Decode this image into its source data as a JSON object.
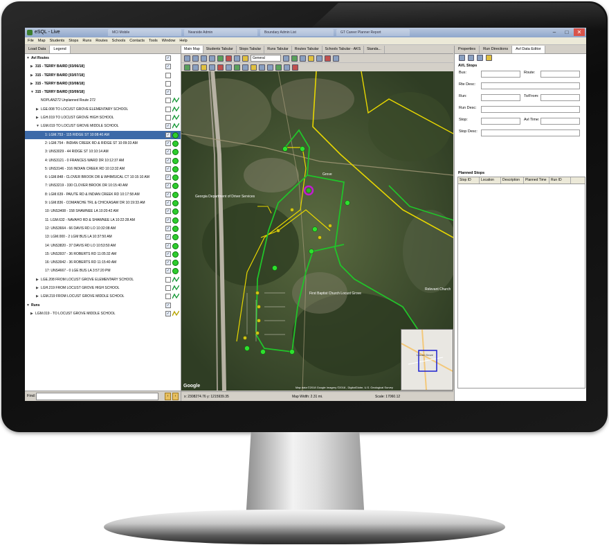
{
  "app": {
    "title": "eSQL - Live",
    "background_tabs": [
      "MCI Mobile",
      "Nearside Admin",
      "Boundary Admin List",
      "GT Career Planner Report"
    ]
  },
  "menu": [
    "File",
    "Map",
    "Students",
    "Stops",
    "Runs",
    "Routes",
    "Schools",
    "Contacts",
    "Tools",
    "Window",
    "Help"
  ],
  "left_panel": {
    "tabs": [
      "Load Data",
      "Legend"
    ],
    "active_tab": "Legend",
    "tree": [
      {
        "text": "Avl Routes",
        "level": 0,
        "bold": true,
        "arrow": "▼",
        "check": true
      },
      {
        "text": "315 - TERRY BAIRD [03/06/18]",
        "level": 1,
        "bold": true,
        "arrow": "▶",
        "check": true
      },
      {
        "text": "315 - TERRY BAIRD [03/07/18]",
        "level": 1,
        "bold": true,
        "arrow": "▶",
        "check": false
      },
      {
        "text": "315 - TERRY BAIRD [03/08/18]",
        "level": 1,
        "bold": true,
        "arrow": "▶",
        "check": false
      },
      {
        "text": "315 - TERRY BAIRD [03/09/18]",
        "level": 1,
        "bold": true,
        "arrow": "▼",
        "check": true
      },
      {
        "text": "NOPLAN272 Unplanned Route 272",
        "level": 2,
        "arrow": "",
        "check": false,
        "icon": "wave"
      },
      {
        "text": "LGE.008 TO LOCUST GROVE ELEMENTARY SCHOOL",
        "level": 2,
        "arrow": "▶",
        "check": false,
        "icon": "wave"
      },
      {
        "text": "LGH.019 TO LOCUST GROVE HIGH SCHOOL",
        "level": 2,
        "arrow": "▶",
        "check": false,
        "icon": "wave"
      },
      {
        "text": "LGM.019 TO LOCUST GROVE MIDDLE SCHOOL",
        "level": 2,
        "arrow": "▼",
        "check": true,
        "icon": "wave"
      },
      {
        "text": "1: LGM.753 - 115 RIDGE ST 10:08:40 AM",
        "level": 3,
        "selected": true,
        "check": true,
        "icon": "dot"
      },
      {
        "text": "2: LGM.754 - INDIAN CREEK RD & RIDGE ST 10:09:33 AM",
        "level": 3,
        "check": true,
        "icon": "dot"
      },
      {
        "text": "3: UNS3029 - 44 RIDGE ST 10:10:14 AM",
        "level": 3,
        "check": true,
        "icon": "dot"
      },
      {
        "text": "4: UNS3121 - 0 FRANCES WARD DR 10:12:37 AM",
        "level": 3,
        "check": true,
        "icon": "dot"
      },
      {
        "text": "5: UNS3146 - 316 INDIAN CREEK RD 10:13:32 AM",
        "level": 3,
        "check": true,
        "icon": "dot"
      },
      {
        "text": "6: LGM.848 - CLOVER BROOK DR & WHIMSICAL CT 10:15:10 AM",
        "level": 3,
        "check": true,
        "icon": "dot"
      },
      {
        "text": "7: UNS3219 - 330 CLOVER BROOK DR 10:15:40 AM",
        "level": 3,
        "check": true,
        "icon": "dot"
      },
      {
        "text": "8: LGM.639 - PAIUTE RD & INDIAN CREEK RD 10:17:58 AM",
        "level": 3,
        "check": true,
        "icon": "dot"
      },
      {
        "text": "9: LGM.836 - COMANCHE TRL & CHICKASAW DR 10:19:33 AM",
        "level": 3,
        "check": true,
        "icon": "dot"
      },
      {
        "text": "10: UNS3408 - 158 SHAWNEE LA 10:20:42 AM",
        "level": 3,
        "check": true,
        "icon": "dot"
      },
      {
        "text": "11: LGM.632 - NAVAHO RD & SHAWNEE LA 10:22:28 AM",
        "level": 3,
        "check": true,
        "icon": "dot"
      },
      {
        "text": "12: UNS3664 - 66 DAVIS RD LO 10:32:08 AM",
        "level": 3,
        "check": true,
        "icon": "dot"
      },
      {
        "text": "13: LGM.000 - 2 LGM BUS LA 10:37:50 AM",
        "level": 3,
        "check": true,
        "icon": "dot"
      },
      {
        "text": "14: UNS3820 - 37 DAVIS RD LO 10:53:50 AM",
        "level": 3,
        "check": true,
        "icon": "dot"
      },
      {
        "text": "15: UNS3937 - 36 ROBERTS RD 11:05:32 AM",
        "level": 3,
        "check": true,
        "icon": "dot"
      },
      {
        "text": "16: UNS3942 - 36 ROBERTS RD 11:15:40 AM",
        "level": 3,
        "check": true,
        "icon": "dot"
      },
      {
        "text": "17: UNS4667 - 0 LGE BUS LA 3:57:20 PM",
        "level": 3,
        "check": true,
        "icon": "dot"
      },
      {
        "text": "LGE.208 FROM LOCUST GROVE ELEMENTARY SCHOOL",
        "level": 2,
        "arrow": "▶",
        "check": false,
        "icon": "wave"
      },
      {
        "text": "LGH.219 FROM LOCUST GROVE HIGH SCHOOL",
        "level": 2,
        "arrow": "▶",
        "check": false,
        "icon": "wave"
      },
      {
        "text": "LGM.219 FROM LOCUST GROVE MIDDLE SCHOOL",
        "level": 2,
        "arrow": "▶",
        "check": false,
        "icon": "wave"
      },
      {
        "text": "Runs",
        "level": 0,
        "bold": true,
        "arrow": "▼",
        "check": true
      },
      {
        "text": "LGM.019 - TO LOCUST GROVE MIDDLE SCHOOL",
        "level": 1,
        "arrow": "▶",
        "check": true,
        "icon": "wave-y"
      }
    ],
    "find_label": "Find:"
  },
  "center_panel": {
    "tabs": [
      "Main Map",
      "Students Tabular",
      "Stops Tabular",
      "Runs Tabular",
      "Routes Tabular",
      "Schools Tabular - AKS",
      "Standa..."
    ],
    "active_tab": "Main Map",
    "layer_select": "General",
    "map_labels": {
      "poi1": "Georgia Department of Driver Services",
      "poi2": "First Baptist Church Locust Grove",
      "poi3": "Relevant Church",
      "grove": "Grove",
      "google": "Google",
      "copyright": "Map data ©2018 Google  Imagery ©2018 , DigitalGlobe, U.S. Geological Survey",
      "inset_label": "Locust Grove"
    },
    "status": {
      "coords": "x: 2308274.76  y: 1215939.35",
      "map_width": "Map Width: 2.31 mi.",
      "scale": "Scale: 17060.12"
    }
  },
  "right_panel": {
    "tabs": [
      "Properties",
      "Run Directions",
      "Avl Data Editor"
    ],
    "active_tab": "Avl Data Editor",
    "avl_stops_title": "AVL Stops",
    "fields": {
      "bus": "Bus:",
      "route": "Route:",
      "rte_desc": "Rte Desc:",
      "run": "Run:",
      "to_from": "To/From:",
      "run_desc": "Run Desc:",
      "stop": "Stop:",
      "avl_time": "Avl Time:",
      "stop_desc": "Stop Desc:"
    },
    "planned_stops_title": "Planned Stops",
    "planned_columns": [
      "Stop ID",
      "Location",
      "Description",
      "Planned Time",
      "Run ID"
    ]
  }
}
